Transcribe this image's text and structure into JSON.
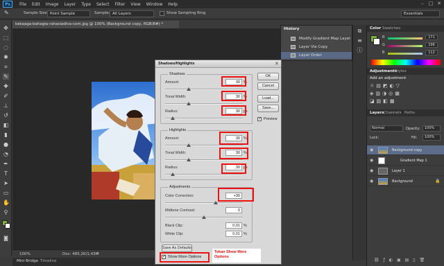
{
  "menubar": {
    "logo": "Ps",
    "items": [
      "File",
      "Edit",
      "Image",
      "Layer",
      "Type",
      "Select",
      "Filter",
      "View",
      "Window",
      "Help"
    ]
  },
  "options": {
    "sample_size_label": "Sample Size:",
    "sample_size_value": "Point Sample",
    "sample_label": "Sample:",
    "sample_value": "All Layers",
    "sampling_ring_label": "Show Sampling Ring",
    "workspace": "Essentials"
  },
  "document": {
    "tab_title": "kekaaga-bahagia-rahasiadiva-com.jpg @ 100% (Background copy, RGB/8#) *",
    "zoom": "100%",
    "doc_size": "Doc: 485,2K/1,43M",
    "bottom_tabs": [
      "Mini Bridge",
      "Timeline"
    ]
  },
  "history": {
    "title": "History",
    "items": [
      "Modify Gradient Map Layer",
      "Layer Via Copy",
      "Layer Order"
    ]
  },
  "color_panel": {
    "tabs": [
      "Color",
      "Swatches"
    ],
    "channels": [
      {
        "label": "R",
        "value": "171"
      },
      {
        "label": "G",
        "value": "196"
      },
      {
        "label": "B",
        "value": "112"
      }
    ]
  },
  "adjustments_panel": {
    "tabs": [
      "Adjustments",
      "Styles"
    ],
    "add_label": "Add an adjustment"
  },
  "layers_panel": {
    "tabs": [
      "Layers",
      "Channels",
      "Paths"
    ],
    "blend_mode": "Normal",
    "opacity_label": "Opacity:",
    "opacity_value": "100%",
    "lock_label": "Lock:",
    "fill_label": "Fill:",
    "fill_value": "100%",
    "layers": [
      {
        "name": "Background copy",
        "selected": true
      },
      {
        "name": "Gradient Map 1",
        "selected": false
      },
      {
        "name": "Layer 1",
        "selected": false
      },
      {
        "name": "Background",
        "selected": false
      }
    ]
  },
  "dialog": {
    "title": "Shadows/Highlights",
    "shadows": {
      "title": "Shadows",
      "amount_label": "Amount:",
      "amount_value": "30",
      "amount_unit": "%",
      "amount_pct": 0.3,
      "tonal_label": "Tonal Width:",
      "tonal_value": "30",
      "tonal_unit": "%",
      "tonal_pct": 0.3,
      "radius_label": "Radius:",
      "radius_value": "30",
      "radius_unit": "px",
      "radius_pct": 0.1
    },
    "highlights": {
      "title": "Highlights",
      "amount_label": "Amount:",
      "amount_value": "30",
      "amount_unit": "%",
      "amount_pct": 0.3,
      "tonal_label": "Tonal Width:",
      "tonal_value": "30",
      "tonal_unit": "%",
      "tonal_pct": 0.3,
      "radius_label": "Radius:",
      "radius_value": "30",
      "radius_unit": "px",
      "radius_pct": 0.1
    },
    "adjustments": {
      "title": "Adjustments",
      "color_label": "Color Correction:",
      "color_value": "+30",
      "color_pct": 0.65,
      "midtone_label": "Midtone Contrast:",
      "midtone_value": "0",
      "midtone_pct": 0.5,
      "black_label": "Black Clip:",
      "black_value": "0,01",
      "black_unit": "%",
      "white_label": "White Clip:",
      "white_value": "0,01",
      "white_unit": "%"
    },
    "buttons": {
      "ok": "OK",
      "cancel": "Cancel",
      "load": "Load...",
      "save": "Save...",
      "save_defaults": "Save As Defaults"
    },
    "preview_label": "Preview",
    "show_more_label": "Show More Options",
    "annotation": "Tekan Show More Options"
  },
  "colors": {
    "annotation_red": "#e11111",
    "ps_blue": "#4ab1ff",
    "foreground": "#7fb23a"
  }
}
